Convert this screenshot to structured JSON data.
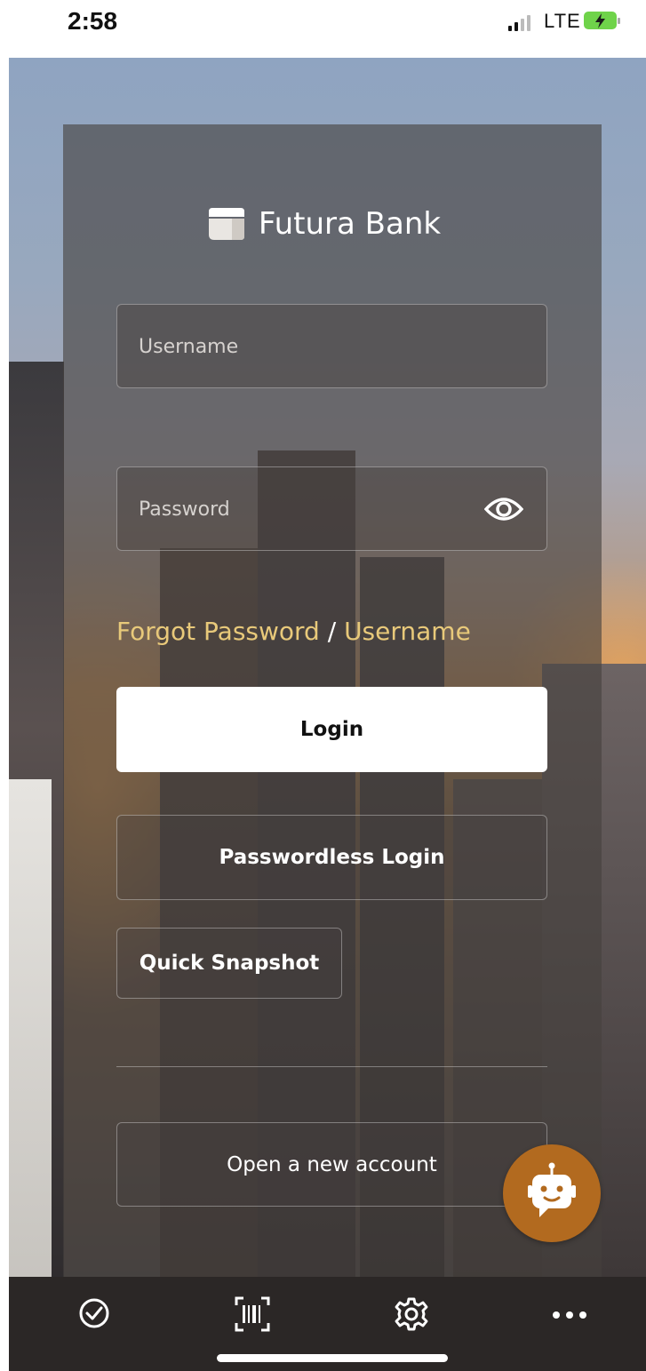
{
  "status_bar": {
    "time": "2:58",
    "network": "LTE",
    "battery": "charging"
  },
  "brand": {
    "logo_icon": "futura-bank-logo-icon",
    "name": "Futura Bank"
  },
  "login_form": {
    "username_placeholder": "Username",
    "password_placeholder": "Password",
    "show_password_icon": "eye-icon",
    "forgot_link": {
      "part1": "Forgot Password",
      "separator": " / ",
      "part2": "Username"
    },
    "login_label": "Login",
    "passwordless_label": "Passwordless Login",
    "quick_snapshot_label": "Quick Snapshot",
    "open_account_label": "Open a new account"
  },
  "chatbot": {
    "icon": "chatbot-icon"
  },
  "toolbar": {
    "items": [
      {
        "icon": "checkmark-circle-icon"
      },
      {
        "icon": "barcode-scanner-icon"
      },
      {
        "icon": "gear-icon"
      },
      {
        "icon": "more-icon"
      }
    ]
  },
  "colors": {
    "accent_link": "#e8c97a",
    "chatbot_bg": "#b26a1f",
    "toolbar_bg": "#2b2726",
    "login_button_bg": "#ffffff"
  }
}
